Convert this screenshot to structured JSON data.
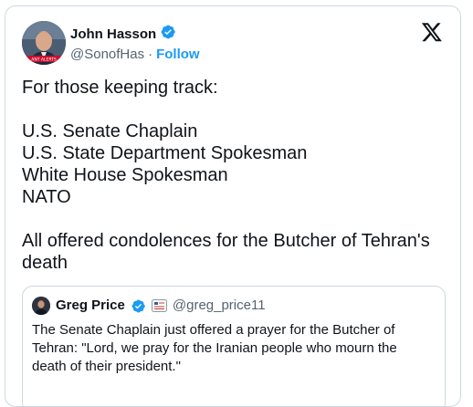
{
  "author": {
    "display_name": "John Hasson",
    "handle": "@SonofHas",
    "separator": "·",
    "follow_label": "Follow",
    "verified_icon": "verified-badge-icon",
    "brand_icon": "x-logo-icon"
  },
  "tweet": {
    "lines": [
      "For those keeping track:",
      "",
      "U.S. Senate Chaplain",
      "U.S. State Department Spokesman",
      "White House Spokesman",
      "NATO",
      "",
      "All offered condolences for the Butcher of Tehran's death"
    ]
  },
  "quoted_tweet": {
    "display_name": "Greg Price",
    "handle": "@greg_price11",
    "text": "The Senate Chaplain just offered a prayer for the Butcher of Tehran: \"Lord, we pray for the Iranian people who mourn the death of their president.\""
  },
  "colors": {
    "accent": "#1d9bf0",
    "text": "#0f1419",
    "secondary": "#536471",
    "border": "#cfd9de"
  }
}
